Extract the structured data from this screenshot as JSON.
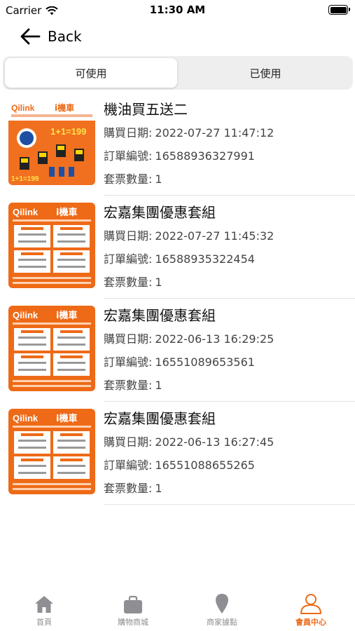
{
  "status": {
    "carrier": "Carrier",
    "time": "11:30 AM"
  },
  "nav": {
    "back_label": "Back"
  },
  "segments": {
    "available": "可使用",
    "used": "已使用"
  },
  "labels": {
    "purchase_date": "購買日期:",
    "order_number": "訂單編號:",
    "ticket_count": "套票數量:"
  },
  "orders": [
    {
      "title": "機油買五送二",
      "purchase_date": "2022-07-27 11:47:12",
      "order_number": "16588936327991",
      "ticket_count": "1"
    },
    {
      "title": "宏嘉集團優惠套組",
      "purchase_date": "2022-07-27 11:45:32",
      "order_number": "16588935322454",
      "ticket_count": "1"
    },
    {
      "title": "宏嘉集團優惠套組",
      "purchase_date": "2022-06-13 16:29:25",
      "order_number": "16551089653561",
      "ticket_count": "1"
    },
    {
      "title": "宏嘉集團優惠套組",
      "purchase_date": "2022-06-13 16:27:45",
      "order_number": "16551088655265",
      "ticket_count": "1"
    }
  ],
  "thumb_text": {
    "brand": "Qilink",
    "brand_suffix": "i機車",
    "promo": "1+1=199"
  },
  "tabs": [
    {
      "label": "首頁",
      "icon": "home-icon"
    },
    {
      "label": "購物商城",
      "icon": "shopping-bag-icon"
    },
    {
      "label": "商家據點",
      "icon": "map-pin-icon"
    },
    {
      "label": "會員中心",
      "icon": "member-icon"
    }
  ],
  "colors": {
    "accent": "#ee6a17",
    "tab_inactive": "#8e8e93"
  }
}
